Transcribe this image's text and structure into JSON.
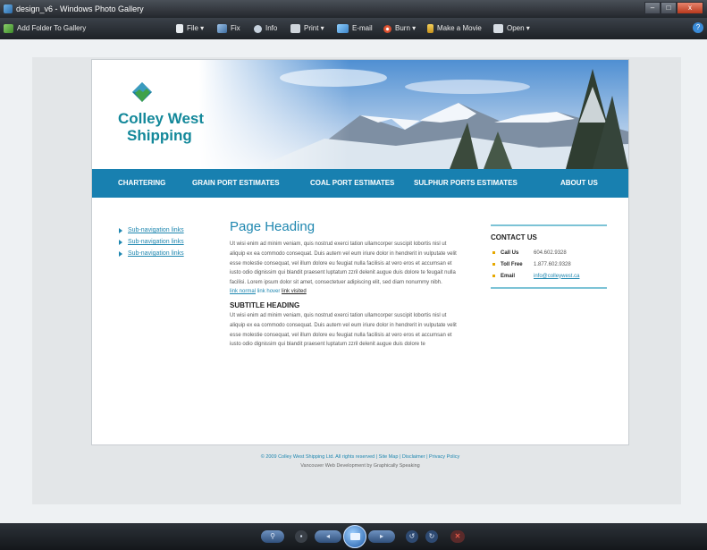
{
  "window": {
    "title": "design_v6 - Windows Photo Gallery",
    "controls": [
      "–",
      "□",
      "x"
    ]
  },
  "toolbar": {
    "add_folder": "Add Folder To Gallery",
    "file": "File ▾",
    "fix": "Fix",
    "info": "Info",
    "print": "Print ▾",
    "email": "E-mail",
    "burn": "Burn ▾",
    "make_movie": "Make a Movie",
    "open": "Open ▾",
    "help": "?"
  },
  "site": {
    "logo": {
      "line1": "Colley West",
      "line2": "Shipping"
    },
    "nav": [
      "CHARTERING",
      "GRAIN PORT ESTIMATES",
      "COAL PORT ESTIMATES",
      "SULPHUR PORTS ESTIMATES",
      "ABOUT US"
    ],
    "subnav": [
      "Sub-navigation links",
      "Sub-navigation links",
      "Sub-navigation links"
    ],
    "heading": "Page Heading",
    "body1": "Ut wisi enim ad minim veniam, quis nostrud exerci tation ullamcorper suscipit lobortis nisl ut aliquip ex ea commodo consequat. Duis autem vel eum iriure dolor in hendrerit in vulputate velit esse molestie consequat, vel illum dolore eu feugiat nulla facilisis at vero eros et accumsan et iusto odio dignissim qui blandit praesent luptatum zzril delenit augue duis dolore te feugait nulla facilisi. Lorem ipsum dolor sit amet, consectetuer adipiscing elit, sed diam nonummy nibh.",
    "link_normal": "link normal",
    "link_hover": "link hover",
    "link_visited": "link visited",
    "subtitle": "SUBTITLE HEADING",
    "body2": "Ut wisi enim ad minim veniam, quis nostrud exerci tation ullamcorper suscipit lobortis nisl ut aliquip ex ea commodo consequat. Duis autem vel eum iriure dolor in hendrerit in vulputate velit esse molestie consequat, vel illum dolore eu feugiat nulla facilisis at vero eros et accumsan et iusto odio dignissim qui blandit praesent luptatum zzril delenit augue duis dolore te",
    "contact": {
      "title": "CONTACT US",
      "rows": [
        {
          "label": "Call Us",
          "value": "604.602.9328"
        },
        {
          "label": "Toll Free",
          "value": "1.877.602.9328"
        },
        {
          "label": "Email",
          "value": "info@colleywest.ca"
        }
      ]
    },
    "footer": {
      "line1": "© 2009 Colley West Shipping Ltd.  All rights reserved  |  Site Map  |  Disclaimer  |  Privacy Policy",
      "line2": "Vancouver Web Development by Graphically Speaking"
    }
  },
  "colors": {
    "nav_bg": "#1880b0",
    "brand_teal": "#13889a",
    "link": "#1f87b0"
  }
}
